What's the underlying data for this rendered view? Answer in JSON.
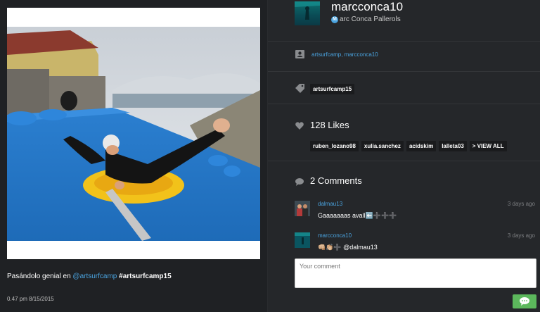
{
  "post": {
    "caption_prefix": "Pasándolo genial en ",
    "caption_mention": "@artsurfcamp",
    "caption_hashtag": "#artsurfcamp15",
    "date": "0.47 pm 8/15/2015"
  },
  "profile": {
    "username": "marcconca10",
    "full_name": "arc Conca Pallerols",
    "verified_badge": "M"
  },
  "tagged": {
    "icon": "person-tag-icon",
    "text": "artsurfcamp, marcconca10"
  },
  "hashtags": {
    "icon": "tag-icon",
    "items": [
      "artsurfcamp15"
    ]
  },
  "likes": {
    "icon": "heart-icon",
    "title": "128 Likes",
    "users": [
      "ruben_lozano98",
      "xulia.sanchez",
      "acidskim",
      "lalleta03"
    ],
    "view_all": "> VIEW ALL"
  },
  "comments": {
    "icon": "speech-bubble-icon",
    "title": "2 Comments",
    "items": [
      {
        "user": "dalmau13",
        "time": "3 days ago",
        "text": "Gaaaaaaas avall⬅️➕➕➕"
      },
      {
        "user": "marcconca10",
        "time": "3 days ago",
        "text": "👊🏼👏🏼➕ @dalmau13"
      }
    ]
  },
  "composer": {
    "placeholder": "Your comment",
    "send_icon": "chat-bubble-icon"
  },
  "colors": {
    "link": "#4aa3df",
    "send": "#5cb85c",
    "panel": "#25272a"
  }
}
